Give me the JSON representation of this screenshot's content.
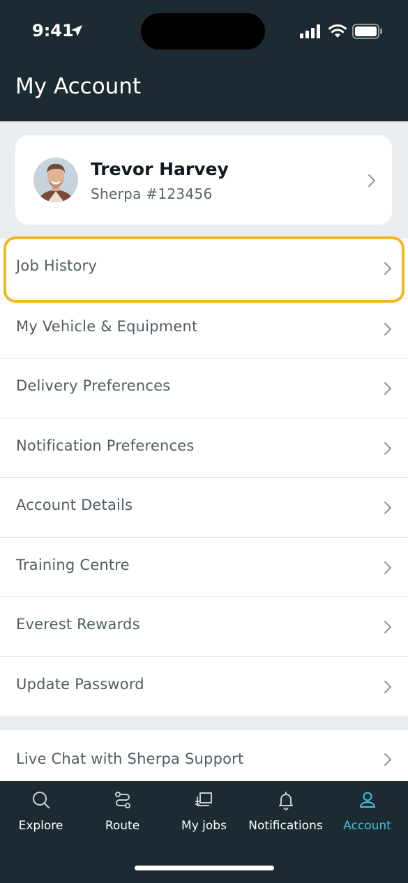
{
  "status_bar": {
    "time": "9:41"
  },
  "header": {
    "title": "My Account"
  },
  "profile": {
    "name": "Trevor Harvey",
    "subtitle": "Sherpa #123456"
  },
  "menu": {
    "items": [
      {
        "label": "Job History"
      },
      {
        "label": "My Vehicle & Equipment"
      },
      {
        "label": "Delivery Preferences"
      },
      {
        "label": "Notification Preferences"
      },
      {
        "label": "Account Details"
      },
      {
        "label": "Training Centre"
      },
      {
        "label": "Everest Rewards"
      },
      {
        "label": "Update Password"
      }
    ]
  },
  "support": {
    "items": [
      {
        "label": "Live Chat with Sherpa Support"
      }
    ]
  },
  "tabs": [
    {
      "label": "Explore",
      "icon": "search-icon"
    },
    {
      "label": "Route",
      "icon": "route-icon"
    },
    {
      "label": "My jobs",
      "icon": "jobs-icon"
    },
    {
      "label": "Notifications",
      "icon": "bell-icon"
    },
    {
      "label": "Account",
      "icon": "user-icon",
      "active": true
    }
  ],
  "colors": {
    "header_bg": "#1c2a31",
    "accent": "#3cc6dc",
    "highlight": "#f6b51e",
    "page_bg": "#e9edf0"
  }
}
